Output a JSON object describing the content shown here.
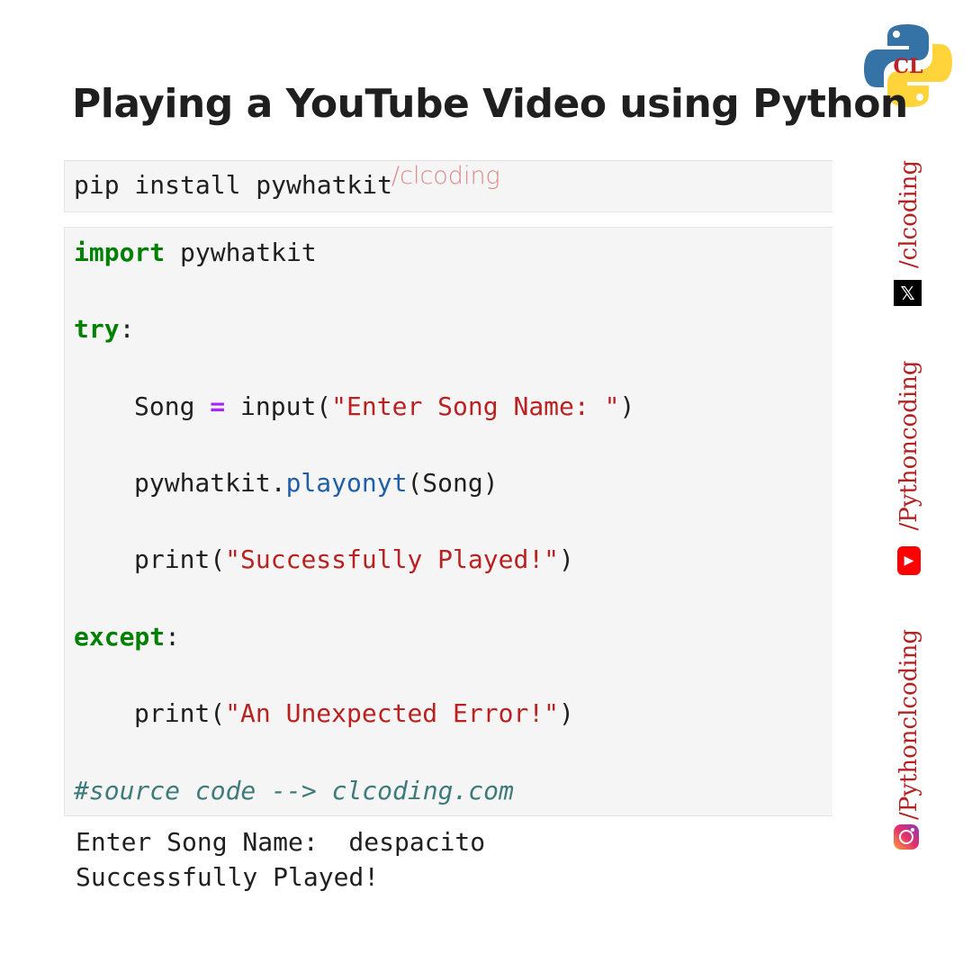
{
  "title": "Playing a YouTube Video using Python",
  "watermark": "/clcoding",
  "pip_cell": {
    "command": "pip install pywhatkit"
  },
  "code": {
    "kw_import": "import",
    "module": " pywhatkit",
    "kw_try": "try",
    "colon": ":",
    "song_var": "Song ",
    "eq": "=",
    "input_call": " input(",
    "prompt_str": "\"Enter Song Name: \"",
    "close_paren": ")",
    "pywhatkit_obj": "pywhatkit.",
    "playonyt_fn": "playonyt",
    "playonyt_arg": "(Song)",
    "print_open": "print(",
    "success_str": "\"Successfully Played!\"",
    "kw_except": "except",
    "error_str": "\"An Unexpected Error!\"",
    "comment": "#source code --> clcoding.com"
  },
  "output": {
    "line1": "Enter Song Name:  despacito",
    "line2": "Successfully Played!"
  },
  "social": {
    "twitter_handle": "/clcoding",
    "youtube_handle": "/Pythoncoding",
    "instagram_handle": "/Pythonclcoding",
    "twitter_glyph": "𝕏",
    "youtube_glyph": "▶"
  },
  "logo": {
    "text": "CL",
    "blue": "#3572a5",
    "yellow": "#ffd43b"
  },
  "colors": {
    "keyword": "#008000",
    "string": "#ba2121",
    "function": "#1f5fa8",
    "operator": "#aa22ff",
    "comment": "#3d7b7b",
    "handle": "#b22222"
  }
}
